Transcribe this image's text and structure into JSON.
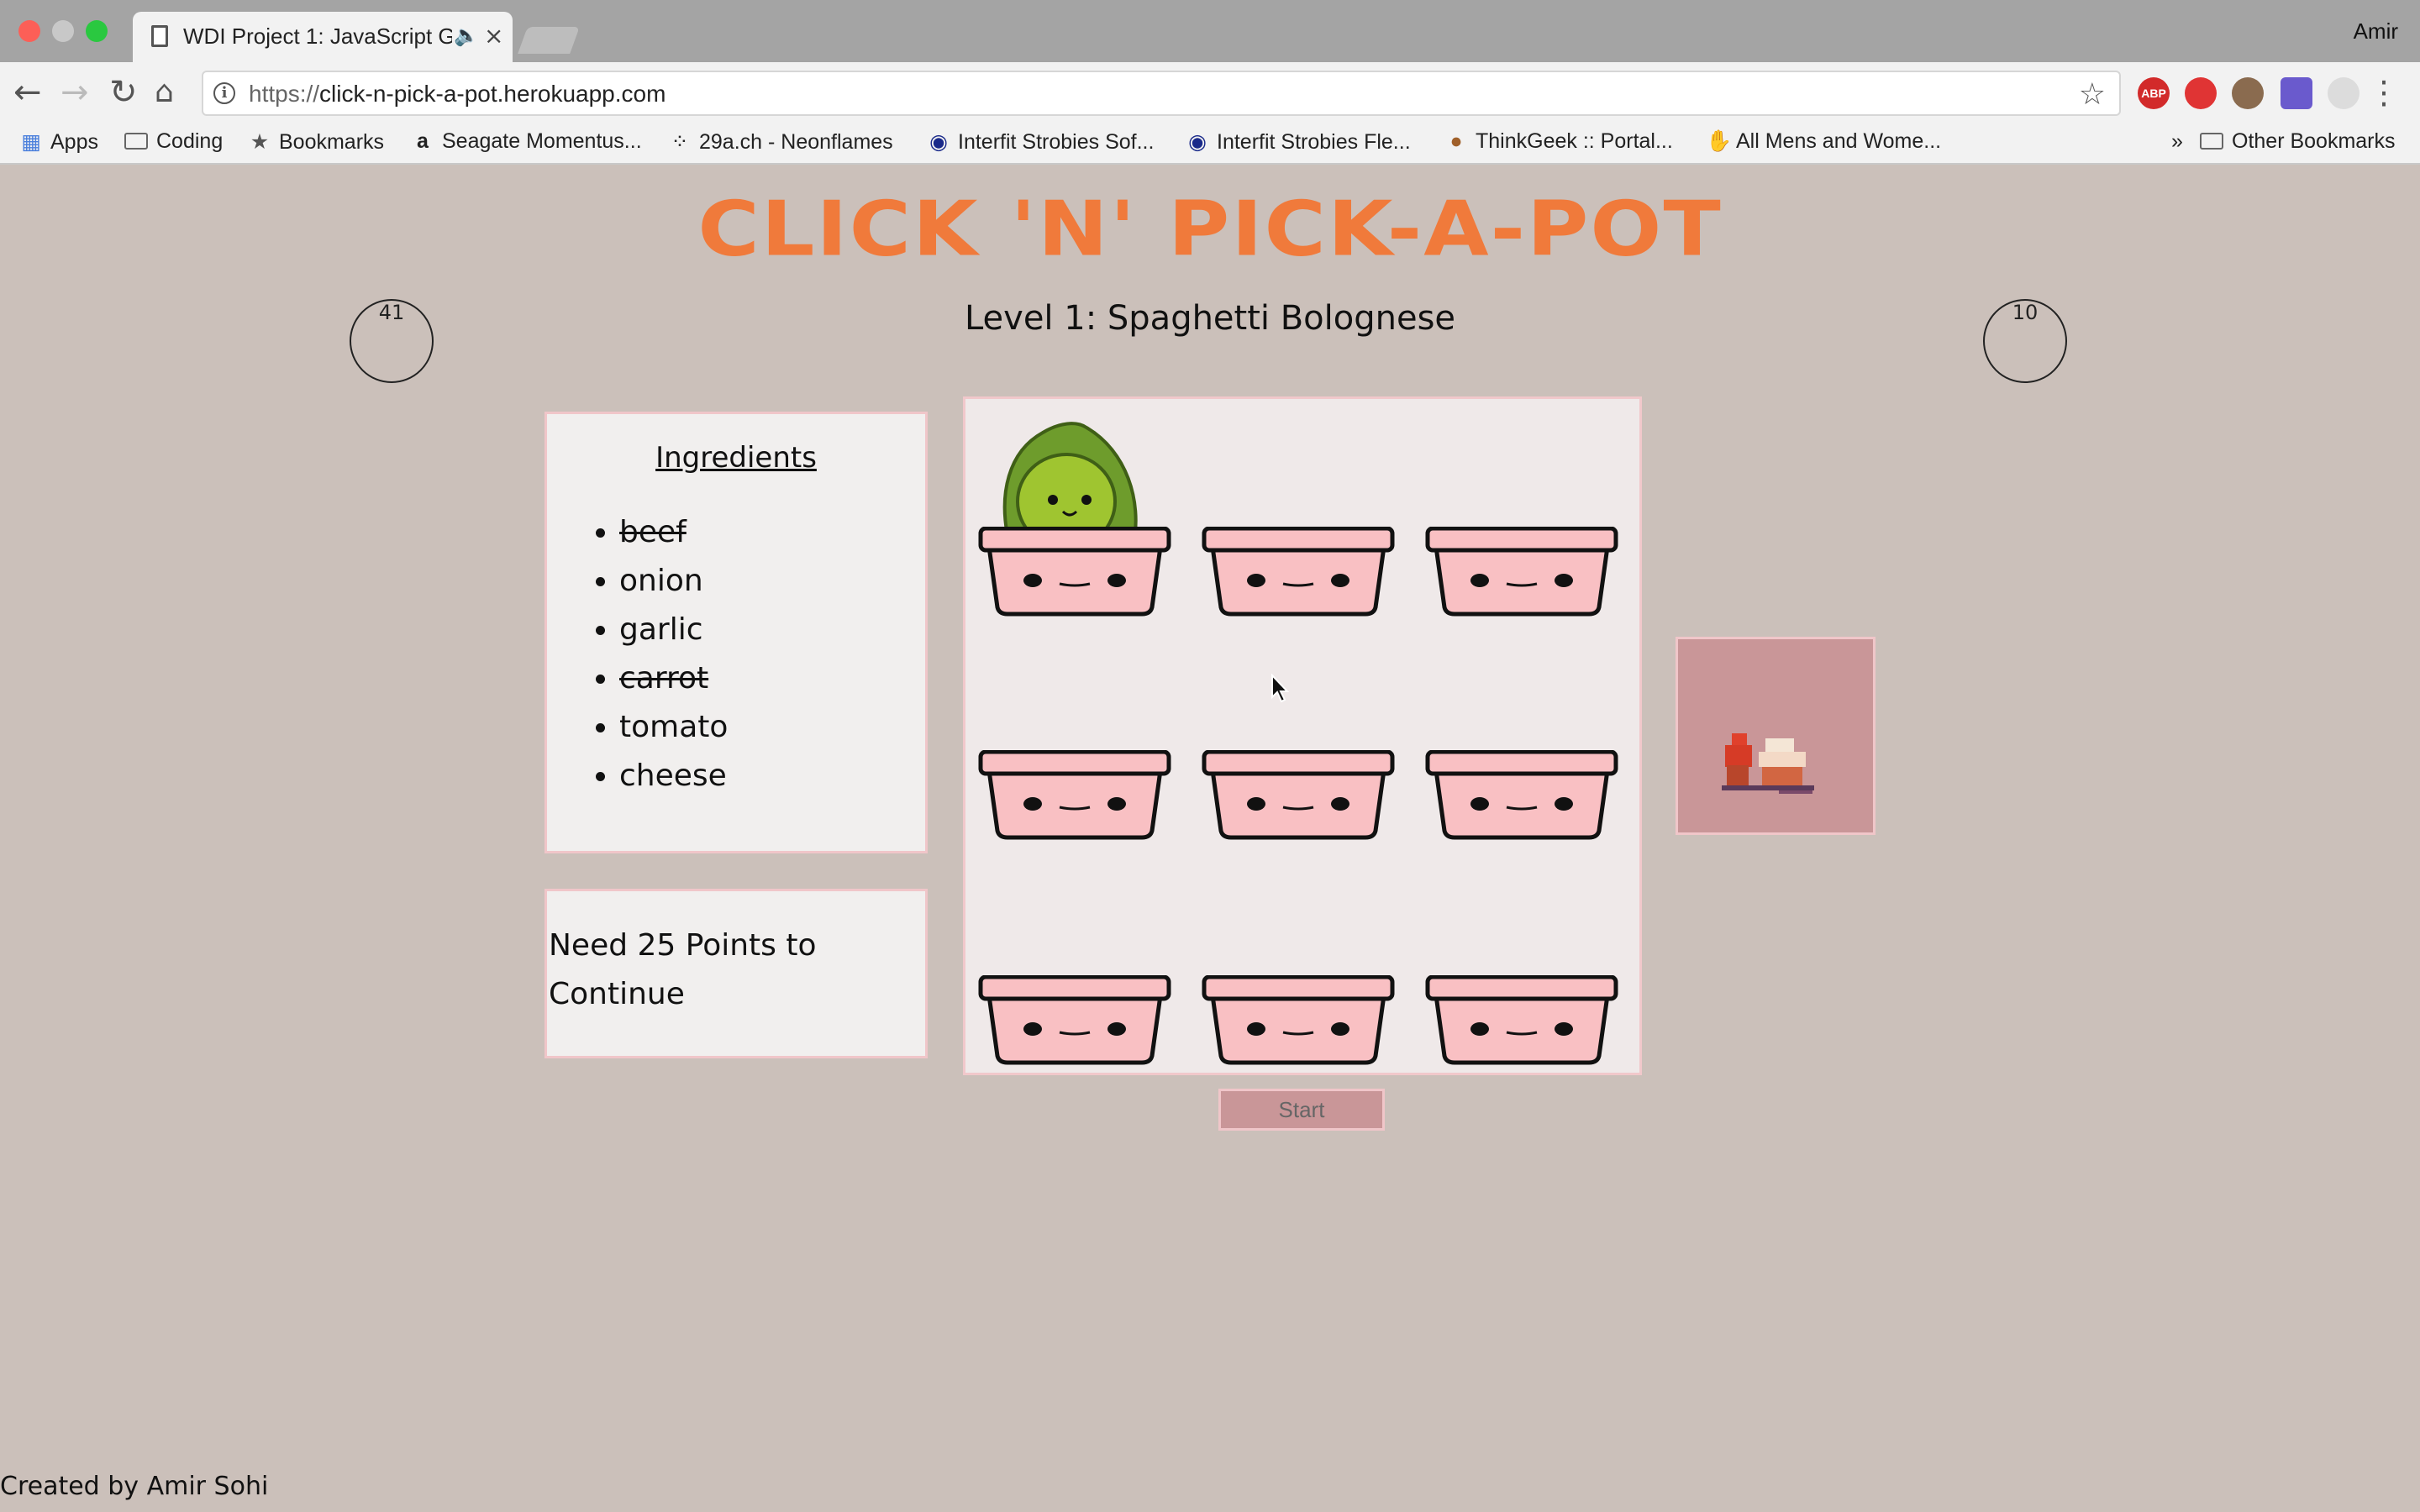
{
  "browser": {
    "tab_title": "WDI Project 1: JavaScript G",
    "tab_audio_icon": "speaker-icon",
    "profile_name": "Amir",
    "url_scheme": "https://",
    "url_host": "click-n-pick-a-pot.herokuapp.com",
    "extensions": [
      {
        "label": "ABP",
        "color": "#d22a2a"
      },
      {
        "label": "",
        "color": "#e03434"
      },
      {
        "label": "",
        "color": "#8a6b4f"
      },
      {
        "label": "",
        "color": "#6a5acd"
      },
      {
        "label": "",
        "color": "#d8d8d8"
      }
    ]
  },
  "bookmarks": {
    "items": [
      {
        "label": "Apps",
        "icon": "apps-grid-icon"
      },
      {
        "label": "Coding",
        "icon": "folder-icon"
      },
      {
        "label": "Bookmarks",
        "icon": "star-icon"
      },
      {
        "label": "Seagate Momentus...",
        "icon": "amazon-icon"
      },
      {
        "label": "29a.ch - Neonflames",
        "icon": "site-icon"
      },
      {
        "label": "Interfit Strobies Sof...",
        "icon": "site-icon"
      },
      {
        "label": "Interfit Strobies Fle...",
        "icon": "site-icon"
      },
      {
        "label": "ThinkGeek :: Portal...",
        "icon": "monkey-icon"
      },
      {
        "label": "All Mens and Wome...",
        "icon": "hand-icon"
      }
    ],
    "overflow": "»",
    "other": "Other Bookmarks"
  },
  "game": {
    "title": "CLICK 'N' PICK-A-POT",
    "level_title": "Level 1: Spaghetti Bolognese",
    "score": "41",
    "timer": "10",
    "ingredients_heading": "Ingredients",
    "ingredients": [
      {
        "name": "beef",
        "collected": true
      },
      {
        "name": "onion",
        "collected": false
      },
      {
        "name": "garlic",
        "collected": false
      },
      {
        "name": "carrot",
        "collected": true
      },
      {
        "name": "tomato",
        "collected": false
      },
      {
        "name": "cheese",
        "collected": false
      }
    ],
    "need_points_text": "Need 25 Points to Continue",
    "start_label": "Start",
    "active_pot": 1,
    "pot_color": "#f9c0c3",
    "accent_color": "#f07a3b"
  },
  "footer": {
    "credit": "Created by Amir Sohi"
  }
}
